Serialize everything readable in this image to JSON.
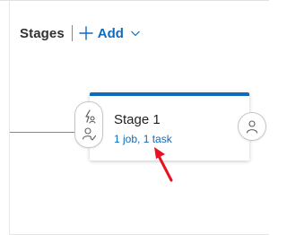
{
  "header": {
    "title": "Stages",
    "add_label": "Add"
  },
  "stage": {
    "name": "Stage 1",
    "summary": "1 job, 1 task"
  },
  "icons": {
    "plus": "plus-icon",
    "chevron": "chevron-down-icon",
    "trigger": "lightning-person-icon",
    "approvers": "person-check-icon",
    "post_approvers": "person-icon",
    "annotation": "red-arrow-icon"
  },
  "colors": {
    "accent": "#0f6cbd",
    "text": "#323130",
    "annotation": "#e81123"
  }
}
